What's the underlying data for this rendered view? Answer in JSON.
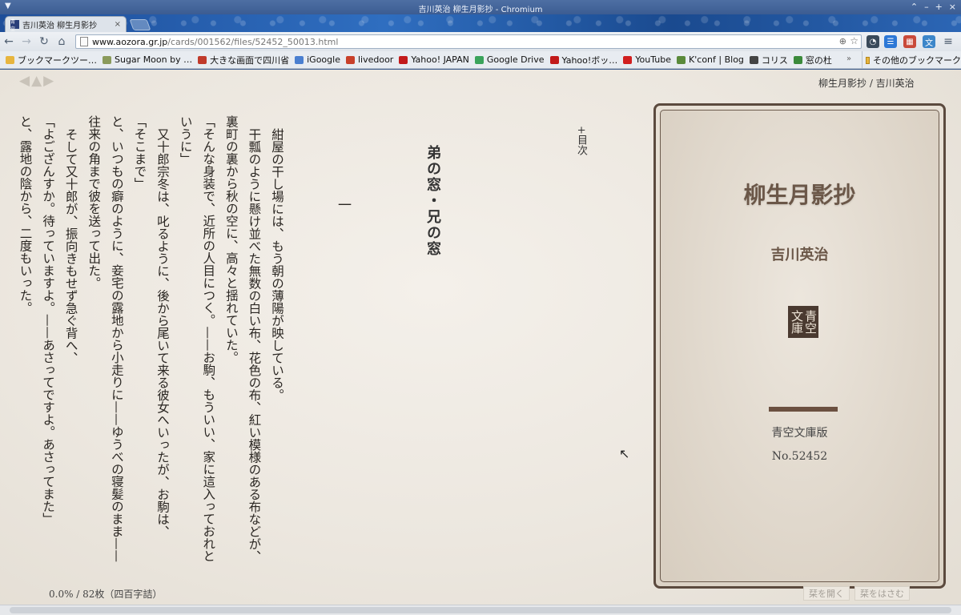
{
  "window": {
    "title": "吉川英治 柳生月影抄 - Chromium",
    "controls": [
      "⌃",
      "–",
      "+",
      "×"
    ]
  },
  "tab": {
    "favicon": "青空",
    "label": "吉川英治 柳生月影抄",
    "close": "×"
  },
  "toolbar": {
    "back": "←",
    "forward": "→",
    "reload": "↻",
    "home": "⌂",
    "url_host": "www.aozora.gr.jp",
    "url_path": "/cards/001562/files/52452_50013.html",
    "zoom": "⊕",
    "star": "☆",
    "menu": "≡"
  },
  "bookmarks": [
    {
      "label": "ブックマークツー…",
      "color": "#e7b53f"
    },
    {
      "label": "Sugar Moon by …",
      "color": "#8a9a5b"
    },
    {
      "label": "大きな画面で四川省",
      "color": "#c03a2b"
    },
    {
      "label": "iGoogle",
      "color": "#4a7fd0"
    },
    {
      "label": "livedoor",
      "color": "#c8402a"
    },
    {
      "label": "Yahoo! JAPAN",
      "color": "#c21a1a"
    },
    {
      "label": "Google Drive",
      "color": "#3aa35b"
    },
    {
      "label": "Yahoo!ボッ…",
      "color": "#c21a1a"
    },
    {
      "label": "YouTube",
      "color": "#d11f1f"
    },
    {
      "label": "K'conf | Blog",
      "color": "#5a8a3a"
    },
    {
      "label": "コリス",
      "color": "#444444"
    },
    {
      "label": "窓の杜",
      "color": "#3b8a3b"
    }
  ],
  "bookmarks_more": "»",
  "bookmarks_other": "その他のブックマーク",
  "reader": {
    "nav": [
      "◀",
      "▲",
      "▶"
    ],
    "breadcrumb": "柳生月影抄 / 吉川英治",
    "toc": "+目次",
    "chapter_title": "弟の窓・兄の窓",
    "section_num": "一",
    "paragraphs": [
      "紺屋の干し場には、もう朝の薄陽が映している。",
      "干瓢のように懸け並べた無数の白い布、花色の布、紅い模様のある布などが、裏町の裏から秋の空に、高々と揺れていた。",
      "「そんな身装で、近所の人目につく。——お駒、もういい、家に這入っておれというに」",
      "又十郎宗冬は、叱るように、後から尾いて来る彼女へいったが、お駒は、",
      "「そこまで」",
      "と、いつもの癖のように、妾宅の露地から小走りに——ゆうべの寝髪のまま——往来の角まで彼を送って出た。",
      "そして又十郎が、振向きもせず急ぐ背へ、",
      "「よござんすか。待っていますよ。——あさってですよ。あさってまた」",
      "と、露地の陰から、二度もいった。"
    ],
    "progress": "0.0% / 82枚（四百字詰）",
    "open_button": "栞を開く",
    "bookmark_button": "栞をはさむ"
  },
  "cover": {
    "title": "柳生月影抄",
    "author": "吉川英治",
    "seal": "青空文庫",
    "edition": "青空文庫版",
    "number": "No.52452"
  },
  "colors": {
    "accent": "#6b5748",
    "cover_border": "#5b4a3e",
    "page_bg": "#ece7df"
  }
}
